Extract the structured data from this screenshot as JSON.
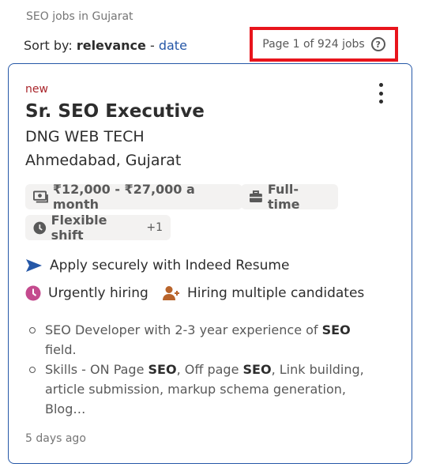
{
  "header": {
    "title": "SEO jobs in Gujarat",
    "sort_label": "Sort by:",
    "sort_active": "relevance",
    "sort_separator": "-",
    "sort_alt": "date",
    "page_count": "Page 1 of 924 jobs"
  },
  "job": {
    "tag": "new",
    "title": "Sr. SEO Executive",
    "company": "DNG WEB TECH",
    "location": "Ahmedabad, Gujarat",
    "salary": "₹12,000 - ₹27,000 a month",
    "job_type": "Full-time",
    "shift": "Flexible shift",
    "shift_more": "+1",
    "apply_text": "Apply securely with Indeed Resume",
    "urgent_text": "Urgently hiring",
    "multi_text": "Hiring multiple candidates",
    "snippet": [
      {
        "pre": "SEO Developer with 2-3 year experience of ",
        "b1": "SEO",
        "mid": " field.",
        "b2": "",
        "mid2": "",
        "b3": "",
        "post": ""
      },
      {
        "pre": "Skills - ON Page ",
        "b1": "SEO",
        "mid": ", Off page ",
        "b2": "SEO",
        "mid2": ", Link building, article submission, markup schema generation, Blog…",
        "b3": "",
        "post": ""
      }
    ],
    "posted": "5 days ago"
  },
  "colors": {
    "accent": "#2557a7",
    "highlight_border": "#e8141c",
    "new_tag": "#a9252b",
    "urgent_icon": "#c44a8e",
    "multi_icon": "#b9642b"
  }
}
